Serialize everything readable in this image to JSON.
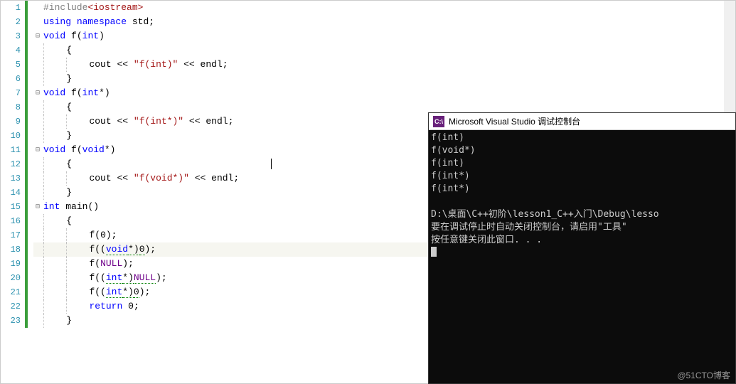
{
  "editor": {
    "lines": [
      {
        "n": 1,
        "fold": "",
        "tokens": [
          [
            "dir",
            "#include"
          ],
          [
            "inc",
            "<iostream>"
          ]
        ]
      },
      {
        "n": 2,
        "fold": "",
        "tokens": [
          [
            "kw",
            "using"
          ],
          [
            "",
            ""
          ],
          [
            "kw",
            "namespace"
          ],
          [
            "",
            ""
          ],
          [
            "id",
            "std"
          ],
          [
            "punc",
            ";"
          ]
        ]
      },
      {
        "n": 3,
        "fold": "⊟",
        "tokens": [
          [
            "kw",
            "void"
          ],
          [
            "",
            ""
          ],
          [
            "id",
            "f"
          ],
          [
            "punc",
            "("
          ],
          [
            "kw",
            "int"
          ],
          [
            "punc",
            ")"
          ]
        ]
      },
      {
        "n": 4,
        "fold": "",
        "indent": 1,
        "tokens": [
          [
            "punc",
            "{"
          ]
        ]
      },
      {
        "n": 5,
        "fold": "",
        "indent": 2,
        "tokens": [
          [
            "id",
            "cout"
          ],
          [
            "",
            ""
          ],
          [
            "punc",
            "<<"
          ],
          [
            "",
            ""
          ],
          [
            "str",
            "\"f(int)\""
          ],
          [
            "",
            ""
          ],
          [
            "punc",
            "<<"
          ],
          [
            "",
            ""
          ],
          [
            "id",
            "endl"
          ],
          [
            "punc",
            ";"
          ]
        ]
      },
      {
        "n": 6,
        "fold": "",
        "indent": 1,
        "tokens": [
          [
            "punc",
            "}"
          ]
        ]
      },
      {
        "n": 7,
        "fold": "⊟",
        "tokens": [
          [
            "kw",
            "void"
          ],
          [
            "",
            ""
          ],
          [
            "id",
            "f"
          ],
          [
            "punc",
            "("
          ],
          [
            "kw",
            "int"
          ],
          [
            "punc",
            "*)"
          ]
        ]
      },
      {
        "n": 8,
        "fold": "",
        "indent": 1,
        "tokens": [
          [
            "punc",
            "{"
          ]
        ]
      },
      {
        "n": 9,
        "fold": "",
        "indent": 2,
        "tokens": [
          [
            "id",
            "cout"
          ],
          [
            "",
            ""
          ],
          [
            "punc",
            "<<"
          ],
          [
            "",
            ""
          ],
          [
            "str",
            "\"f(int*)\""
          ],
          [
            "",
            ""
          ],
          [
            "punc",
            "<<"
          ],
          [
            "",
            ""
          ],
          [
            "id",
            "endl"
          ],
          [
            "punc",
            ";"
          ]
        ]
      },
      {
        "n": 10,
        "fold": "",
        "indent": 1,
        "tokens": [
          [
            "punc",
            "}"
          ]
        ]
      },
      {
        "n": 11,
        "fold": "⊟",
        "tokens": [
          [
            "kw",
            "void"
          ],
          [
            "",
            ""
          ],
          [
            "id",
            "f"
          ],
          [
            "punc",
            "("
          ],
          [
            "kw",
            "void"
          ],
          [
            "punc",
            "*)"
          ]
        ]
      },
      {
        "n": 12,
        "fold": "",
        "indent": 1,
        "tokens": [
          [
            "punc",
            "{"
          ]
        ],
        "cursor": true
      },
      {
        "n": 13,
        "fold": "",
        "indent": 2,
        "tokens": [
          [
            "id",
            "cout"
          ],
          [
            "",
            ""
          ],
          [
            "punc",
            "<<"
          ],
          [
            "",
            ""
          ],
          [
            "str",
            "\"f(void*)\""
          ],
          [
            "",
            ""
          ],
          [
            "punc",
            "<<"
          ],
          [
            "",
            ""
          ],
          [
            "id",
            "endl"
          ],
          [
            "punc",
            ";"
          ]
        ]
      },
      {
        "n": 14,
        "fold": "",
        "indent": 1,
        "tokens": [
          [
            "punc",
            "}"
          ]
        ]
      },
      {
        "n": 15,
        "fold": "⊟",
        "tokens": [
          [
            "kw",
            "int"
          ],
          [
            "",
            ""
          ],
          [
            "id",
            "main"
          ],
          [
            "punc",
            "()"
          ]
        ]
      },
      {
        "n": 16,
        "fold": "",
        "indent": 1,
        "tokens": [
          [
            "punc",
            "{"
          ]
        ]
      },
      {
        "n": 17,
        "fold": "",
        "indent": 2,
        "tokens": [
          [
            "id",
            "f"
          ],
          [
            "punc",
            "("
          ],
          [
            "id",
            "0"
          ],
          [
            "punc",
            ");"
          ]
        ]
      },
      {
        "n": 18,
        "fold": "",
        "indent": 2,
        "current": true,
        "tokens": [
          [
            "id",
            "f"
          ],
          [
            "punc",
            "(("
          ],
          [
            "kw-sq",
            "void"
          ],
          [
            "punc-sq",
            "*)"
          ],
          [
            "id-sq",
            "0"
          ],
          [
            "punc",
            ");"
          ]
        ]
      },
      {
        "n": 19,
        "fold": "",
        "indent": 2,
        "tokens": [
          [
            "id",
            "f"
          ],
          [
            "punc",
            "("
          ],
          [
            "macro",
            "NULL"
          ],
          [
            "punc",
            ");"
          ]
        ]
      },
      {
        "n": 20,
        "fold": "",
        "indent": 2,
        "tokens": [
          [
            "id",
            "f"
          ],
          [
            "punc",
            "(("
          ],
          [
            "kw-sq",
            "int"
          ],
          [
            "punc-sq",
            "*)"
          ],
          [
            "macro-sq",
            "NULL"
          ],
          [
            "punc",
            ");"
          ]
        ]
      },
      {
        "n": 21,
        "fold": "",
        "indent": 2,
        "tokens": [
          [
            "id",
            "f"
          ],
          [
            "punc",
            "(("
          ],
          [
            "kw-sq",
            "int"
          ],
          [
            "punc-sq",
            "*)"
          ],
          [
            "id-sq",
            "0"
          ],
          [
            "punc",
            ");"
          ]
        ]
      },
      {
        "n": 22,
        "fold": "",
        "indent": 2,
        "tokens": [
          [
            "kw",
            "return"
          ],
          [
            "",
            ""
          ],
          [
            "id",
            "0"
          ],
          [
            "punc",
            ";"
          ]
        ]
      },
      {
        "n": 23,
        "fold": "",
        "indent": 1,
        "tokens": [
          [
            "punc",
            "}"
          ]
        ]
      }
    ]
  },
  "console": {
    "title": "Microsoft Visual Studio 调试控制台",
    "icon": "C:\\",
    "output": [
      "f(int)",
      "f(void*)",
      "f(int)",
      "f(int*)",
      "f(int*)",
      "",
      "D:\\桌面\\C++初阶\\lesson1_C++入门\\Debug\\lesso",
      "要在调试停止时自动关闭控制台，请启用\"工具\"",
      "按任意键关闭此窗口. . ."
    ]
  },
  "watermark": "@51CTO博客"
}
